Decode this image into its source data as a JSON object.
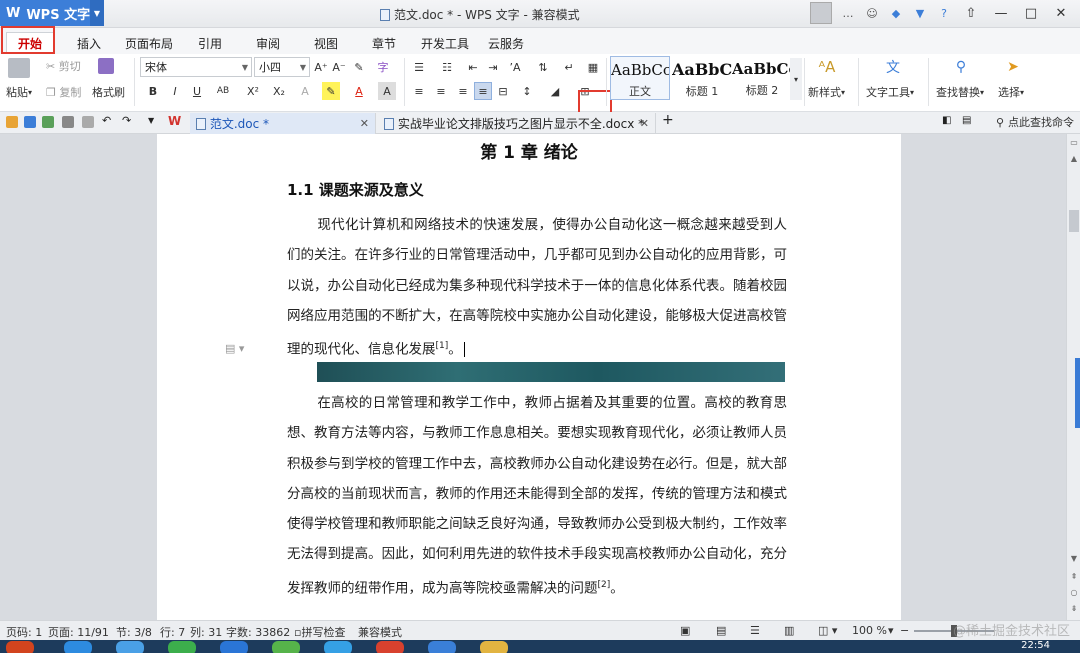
{
  "app": {
    "name": "WPS 文字",
    "window_title": "范文.doc * - WPS 文字 - 兼容模式"
  },
  "menu_tabs": [
    "开始",
    "插入",
    "页面布局",
    "引用",
    "审阅",
    "视图",
    "章节",
    "开发工具",
    "云服务"
  ],
  "ribbon": {
    "paste": "粘贴",
    "cut": "剪切",
    "copy": "复制",
    "format_painter": "格式刷",
    "font_name": "宋体",
    "font_size": "小四",
    "styles": [
      {
        "preview": "AaBbCcI",
        "name": "正文"
      },
      {
        "preview": "AaBbCc",
        "name": "标题 1"
      },
      {
        "preview": "AaBbCcI",
        "name": "标题 2"
      }
    ],
    "new_style": "新样式",
    "text_tools": "文字工具",
    "find_replace": "查找替换",
    "select": "选择"
  },
  "doc_tabs": [
    {
      "label": "范文.doc *",
      "active": true
    },
    {
      "label": "实战毕业论文排版技巧之图片显示不全.docx *",
      "active": false
    }
  ],
  "find_command": "点此查找命令",
  "document": {
    "chapter_title": "第 1 章  绪论",
    "section_title": "1.1  课题来源及意义",
    "para1": "现代化计算机和网络技术的快速发展，使得办公自动化这一概念越来越受到人们的关注。在许多行业的日常管理活动中，几乎都可见到办公自动化的应用背影，可以说，办公自动化已经成为集多种现代科学技术于一体的信息化体系代表。随着校园网络应用范围的不断扩大，在高等院校中实施办公自动化建设，能够极大促进高校管理的现代化、信息化发展",
    "para1_ref": "[1]",
    "para1_end": "。",
    "para2": "在高校的日常管理和教学工作中，教师占据着及其重要的位置。高校的教育思想、教育方法等内容，与教师工作息息相关。要想实现教育现代化，必须让教师人员积极参与到学校的管理工作中去，高校教师办公自动化建设势在必行。但是，就大部分高校的当前现状而言，教师的作用还未能得到全部的发挥，传统的管理方法和模式使得学校管理和教师职能之间缺乏良好沟通，导致教师办公受到极大制约，工作效率无法得到提高。因此，如何利用先进的软件技术手段实现高校教师办公自动化，充分发挥教师的纽带作用，成为高等院校亟需解决的问题",
    "para2_ref": "[2]",
    "para2_end": "。"
  },
  "status": {
    "page_code": "页码: 1",
    "page": "页面: 11/91",
    "section": "节: 3/8",
    "row": "行: 7",
    "col": "列: 31",
    "word_count": "字数: 33862",
    "spell_check": "拼写检查",
    "compat": "兼容模式",
    "zoom": "100 %"
  },
  "watermark": "@稀土掘金技术社区",
  "clock": "22:54",
  "colors": {
    "accent": "#3c7ed8",
    "highlight_box": "#e23b2f",
    "active_tab_text": "#cc0000"
  }
}
